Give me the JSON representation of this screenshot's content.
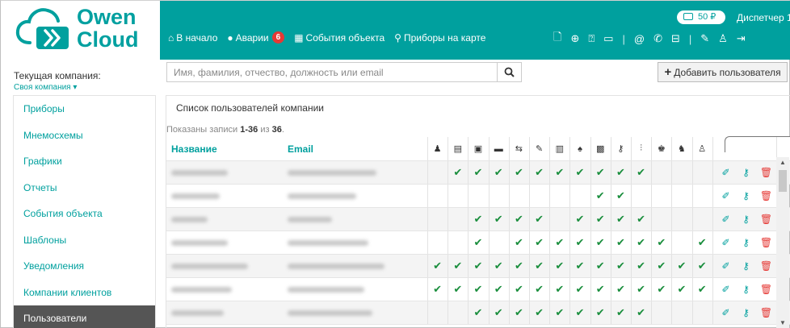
{
  "brand": {
    "line1": "Owen",
    "line2": "Cloud"
  },
  "header": {
    "balance": "50 ₽",
    "dispatcher": "Диспетчер 1",
    "nav": [
      {
        "icon": "home-icon",
        "glyph": "⌂",
        "label": "В начало"
      },
      {
        "icon": "alert-icon",
        "glyph": "●",
        "label": "Аварии",
        "badge": "6"
      },
      {
        "icon": "events-icon",
        "glyph": "▦",
        "label": "События объекта"
      },
      {
        "icon": "map-pin-icon",
        "glyph": "⚲",
        "label": "Приборы на карте"
      }
    ]
  },
  "sidebar": {
    "company_label": "Текущая компания:",
    "company_value": "Своя компания ▾",
    "items": [
      {
        "label": "Приборы"
      },
      {
        "label": "Мнемосхемы"
      },
      {
        "label": "Графики"
      },
      {
        "label": "Отчеты"
      },
      {
        "label": "События объекта"
      },
      {
        "label": "Шаблоны"
      },
      {
        "label": "Уведомления"
      },
      {
        "label": "Компании клиентов"
      },
      {
        "label": "Пользователи",
        "active": true
      }
    ]
  },
  "search": {
    "placeholder": "Имя, фамилия, отчество, должность или email"
  },
  "add_button": "Добавить пользователя",
  "panel": {
    "title": "Список пользователей компании",
    "summary_prefix": "Показаны записи ",
    "summary_range": "1-36",
    "summary_mid": " из ",
    "summary_total": "36",
    "summary_end": "."
  },
  "table": {
    "col_name": "Название",
    "col_email": "Email",
    "perm_icons": [
      "user-icon",
      "document-icon",
      "folder-icon",
      "card-icon",
      "device-icon",
      "chart-icon",
      "report-icon",
      "bell-icon",
      "image-icon",
      "key-icon",
      "settings-icon",
      "admin-icon",
      "user-key-icon",
      "user-edit-icon"
    ],
    "perm_glyphs": [
      "♟",
      "▤",
      "▣",
      "▬",
      "⇆",
      "✎",
      "▥",
      "♠",
      "▩",
      "⚷",
      "⫶",
      "♚",
      "♞",
      "♙"
    ],
    "rows": [
      [
        0,
        1,
        1,
        1,
        1,
        1,
        1,
        1,
        1,
        1,
        1,
        0,
        0,
        0
      ],
      [
        0,
        0,
        0,
        0,
        0,
        0,
        0,
        0,
        1,
        1,
        0,
        0,
        0,
        0
      ],
      [
        0,
        0,
        1,
        1,
        1,
        1,
        0,
        1,
        1,
        1,
        1,
        0,
        0,
        0
      ],
      [
        0,
        0,
        1,
        0,
        1,
        1,
        1,
        1,
        1,
        1,
        1,
        1,
        0,
        1
      ],
      [
        1,
        1,
        1,
        1,
        1,
        1,
        1,
        1,
        1,
        1,
        1,
        1,
        1,
        1
      ],
      [
        1,
        1,
        1,
        1,
        1,
        1,
        1,
        1,
        1,
        1,
        1,
        1,
        1,
        1
      ],
      [
        0,
        0,
        1,
        1,
        1,
        1,
        1,
        1,
        1,
        1,
        1,
        0,
        0,
        0
      ]
    ]
  }
}
